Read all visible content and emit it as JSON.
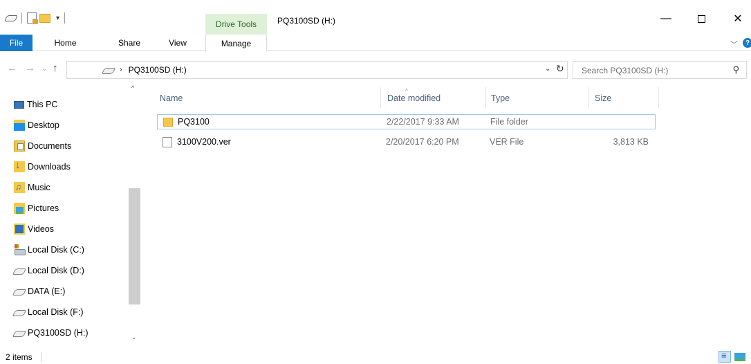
{
  "window": {
    "title": "PQ3100SD (H:)",
    "context_tab_group": "Drive Tools",
    "controls": {
      "minimize": "—",
      "maximize": "□",
      "close": "✕"
    }
  },
  "quick_access_toolbar": {
    "dropdown": "▾"
  },
  "ribbon": {
    "tabs": [
      {
        "label": "File"
      },
      {
        "label": "Home"
      },
      {
        "label": "Share"
      },
      {
        "label": "View"
      },
      {
        "label": "Manage"
      }
    ],
    "expand_glyph": "﹀",
    "help": "?"
  },
  "navigation": {
    "back": "←",
    "forward": "→",
    "recent": "⌄",
    "up": "↑",
    "address_chevron": "›",
    "address_path": "PQ3100SD (H:)",
    "address_dropdown": "⌄",
    "refresh": "↻",
    "search_placeholder": "Search PQ3100SD (H:)",
    "search_glyph": "⚲"
  },
  "nav_pane": {
    "scroll_up": "^",
    "scroll_down": "⌄",
    "items": [
      {
        "label": "This PC",
        "icon": "computer-icon"
      },
      {
        "label": "Desktop",
        "icon": "desktop-icon"
      },
      {
        "label": "Documents",
        "icon": "documents-icon"
      },
      {
        "label": "Downloads",
        "icon": "downloads-icon"
      },
      {
        "label": "Music",
        "icon": "music-icon"
      },
      {
        "label": "Pictures",
        "icon": "pictures-icon"
      },
      {
        "label": "Videos",
        "icon": "videos-icon"
      },
      {
        "label": "Local Disk (C:)",
        "icon": "windows-drive-icon"
      },
      {
        "label": "Local Disk (D:)",
        "icon": "drive-icon"
      },
      {
        "label": "DATA (E:)",
        "icon": "drive-icon"
      },
      {
        "label": "Local Disk (F:)",
        "icon": "drive-icon"
      },
      {
        "label": "PQ3100SD (H:)",
        "icon": "drive-icon"
      }
    ]
  },
  "file_list": {
    "columns": {
      "name": "Name",
      "date": "Date modified",
      "type": "Type",
      "size": "Size"
    },
    "sort_glyph": "^",
    "rows": [
      {
        "name": "PQ3100",
        "date": "2/22/2017 9:33 AM",
        "type": "File folder",
        "size": "",
        "icon": "folder-icon"
      },
      {
        "name": "3100V200.ver",
        "date": "2/20/2017 6:20 PM",
        "type": "VER File",
        "size": "3,813 KB",
        "icon": "file-icon"
      }
    ]
  },
  "status_bar": {
    "item_count": "2 items"
  },
  "colors": {
    "accent": "#1979ca",
    "context_tab": "#dff0d8",
    "selection_border": "#99c9ef",
    "header_text": "#4c607a"
  }
}
